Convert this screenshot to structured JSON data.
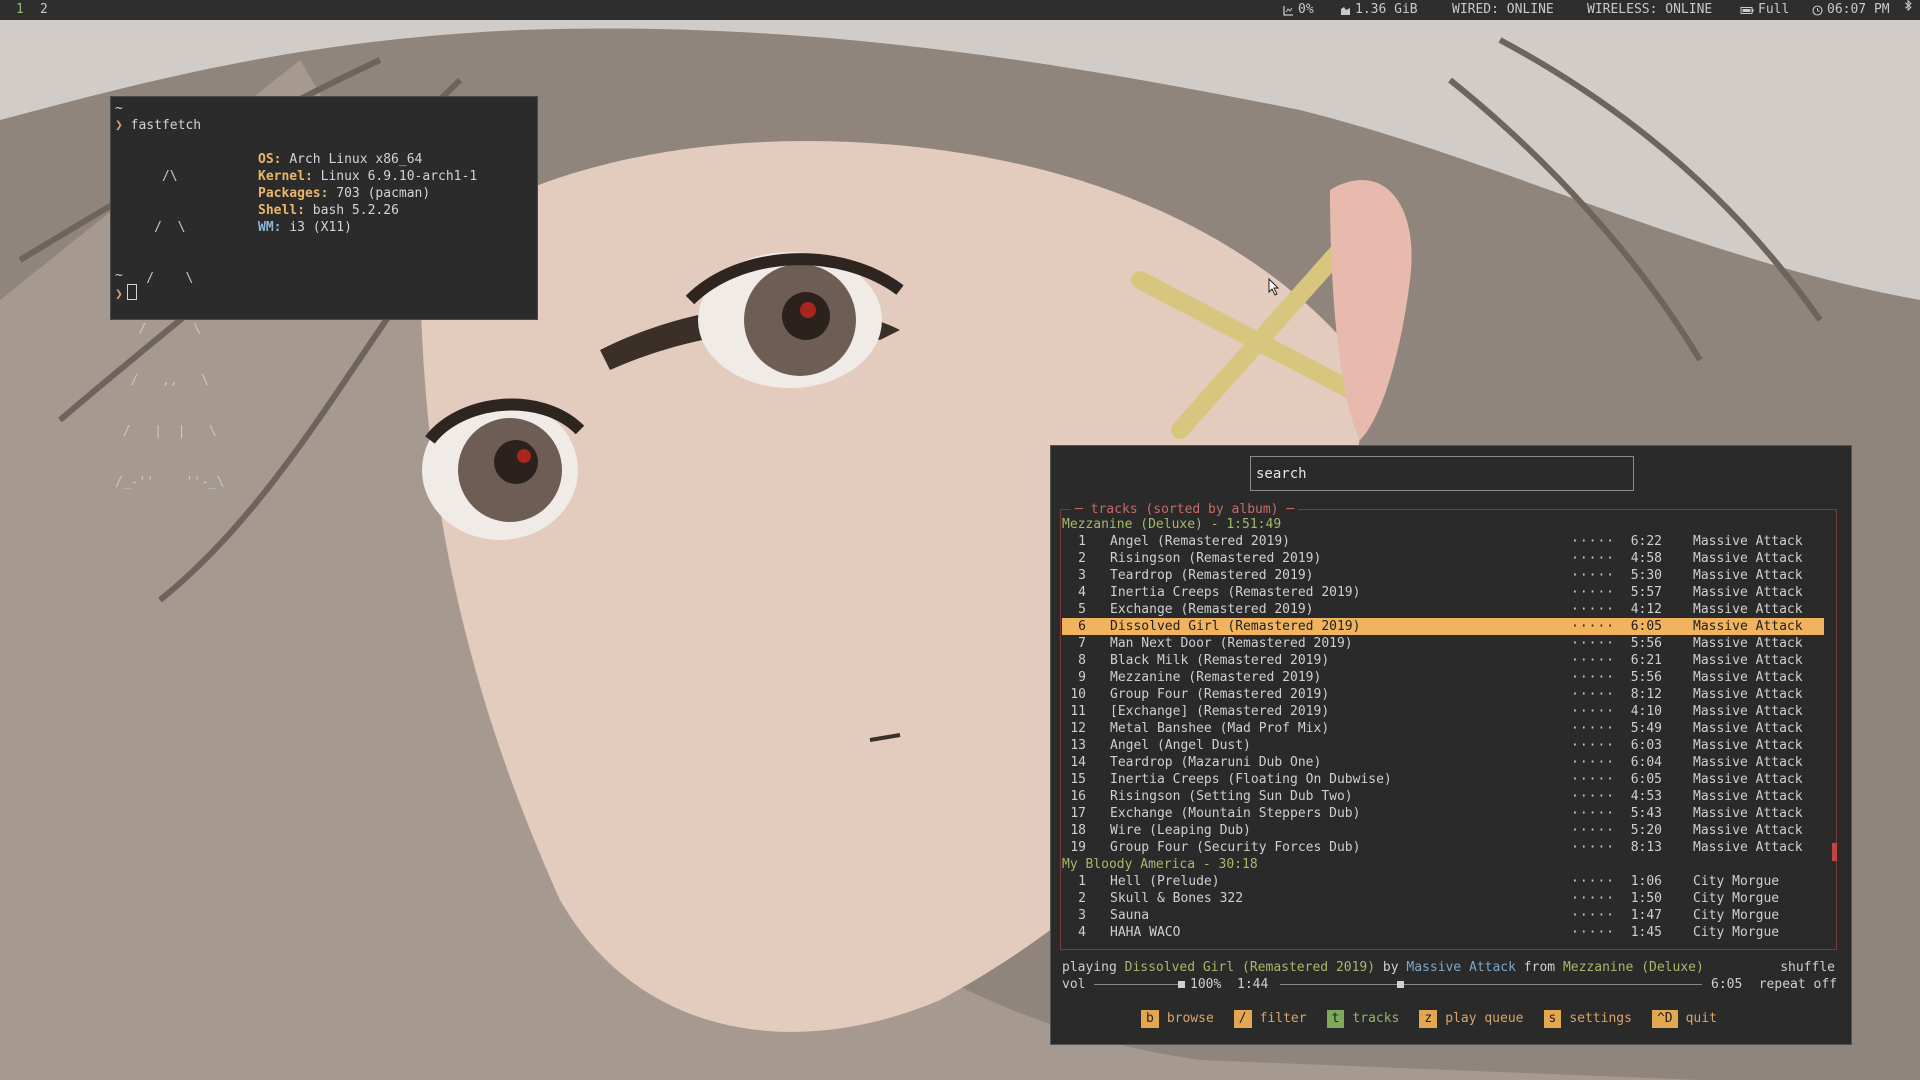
{
  "topbar": {
    "workspaces": [
      "1",
      "2"
    ],
    "cpu": "0%",
    "memory": "1.36 GiB",
    "wired": "WIRED: ONLINE",
    "wireless": "WIRELESS: ONLINE",
    "battery": "Full",
    "clock": "06:07 PM",
    "icons": [
      "cpu-icon",
      "memory-icon",
      "battery-icon",
      "clock-icon",
      "bluetooth-icon"
    ]
  },
  "terminal": {
    "line1": "~",
    "command": "fastfetch",
    "prompt_symbol": "❯",
    "logo_lines": [
      "      /\\",
      "     /  \\",
      "    /    \\",
      "   /      \\",
      "  /   ,,   \\",
      " /   |  |   \\",
      "/_-''    ''-_\\"
    ],
    "info": [
      {
        "key": "OS",
        "value": "Arch Linux x86_64"
      },
      {
        "key": "Kernel",
        "value": "Linux 6.9.10-arch1-1"
      },
      {
        "key": "Packages",
        "value": "703 (pacman)"
      },
      {
        "key": "Shell",
        "value": "bash 5.2.26"
      },
      {
        "key": "WM",
        "value": "i3 (X11)"
      }
    ],
    "line_after": "~"
  },
  "player": {
    "search_placeholder": "search",
    "box_title": "tracks (sorted by album)",
    "albums": [
      {
        "header": "Mezzanine (Deluxe) - 1:51:49",
        "tracks": [
          {
            "num": "1",
            "title": "Angel (Remastered 2019)",
            "rating": "·····",
            "duration": "6:22",
            "artist": "Massive Attack"
          },
          {
            "num": "2",
            "title": "Risingson (Remastered 2019)",
            "rating": "·····",
            "duration": "4:58",
            "artist": "Massive Attack"
          },
          {
            "num": "3",
            "title": "Teardrop (Remastered 2019)",
            "rating": "·····",
            "duration": "5:30",
            "artist": "Massive Attack"
          },
          {
            "num": "4",
            "title": "Inertia Creeps (Remastered 2019)",
            "rating": "·····",
            "duration": "5:57",
            "artist": "Massive Attack"
          },
          {
            "num": "5",
            "title": "Exchange (Remastered 2019)",
            "rating": "·····",
            "duration": "4:12",
            "artist": "Massive Attack"
          },
          {
            "num": "6",
            "title": "Dissolved Girl (Remastered 2019)",
            "rating": "·····",
            "duration": "6:05",
            "artist": "Massive Attack",
            "selected": true
          },
          {
            "num": "7",
            "title": "Man Next Door (Remastered 2019)",
            "rating": "·····",
            "duration": "5:56",
            "artist": "Massive Attack"
          },
          {
            "num": "8",
            "title": "Black Milk (Remastered 2019)",
            "rating": "·····",
            "duration": "6:21",
            "artist": "Massive Attack"
          },
          {
            "num": "9",
            "title": "Mezzanine (Remastered 2019)",
            "rating": "·····",
            "duration": "5:56",
            "artist": "Massive Attack"
          },
          {
            "num": "10",
            "title": "Group Four (Remastered 2019)",
            "rating": "·····",
            "duration": "8:12",
            "artist": "Massive Attack"
          },
          {
            "num": "11",
            "title": "[Exchange] (Remastered 2019)",
            "rating": "·····",
            "duration": "4:10",
            "artist": "Massive Attack"
          },
          {
            "num": "12",
            "title": "Metal Banshee (Mad Prof Mix)",
            "rating": "·····",
            "duration": "5:49",
            "artist": "Massive Attack"
          },
          {
            "num": "13",
            "title": "Angel (Angel Dust)",
            "rating": "·····",
            "duration": "6:03",
            "artist": "Massive Attack"
          },
          {
            "num": "14",
            "title": "Teardrop (Mazaruni Dub One)",
            "rating": "·····",
            "duration": "6:04",
            "artist": "Massive Attack"
          },
          {
            "num": "15",
            "title": "Inertia Creeps (Floating On Dubwise)",
            "rating": "·····",
            "duration": "6:05",
            "artist": "Massive Attack"
          },
          {
            "num": "16",
            "title": "Risingson (Setting Sun Dub Two)",
            "rating": "·····",
            "duration": "4:53",
            "artist": "Massive Attack"
          },
          {
            "num": "17",
            "title": "Exchange (Mountain Steppers Dub)",
            "rating": "·····",
            "duration": "5:43",
            "artist": "Massive Attack"
          },
          {
            "num": "18",
            "title": "Wire (Leaping Dub)",
            "rating": "·····",
            "duration": "5:20",
            "artist": "Massive Attack"
          },
          {
            "num": "19",
            "title": "Group Four (Security Forces Dub)",
            "rating": "·····",
            "duration": "8:13",
            "artist": "Massive Attack"
          }
        ]
      },
      {
        "header": "My Bloody America - 30:18",
        "tracks": [
          {
            "num": "1",
            "title": "Hell (Prelude)",
            "rating": "·····",
            "duration": "1:06",
            "artist": "City Morgue"
          },
          {
            "num": "2",
            "title": "Skull & Bones 322",
            "rating": "·····",
            "duration": "1:50",
            "artist": "City Morgue"
          },
          {
            "num": "3",
            "title": "Sauna",
            "rating": "·····",
            "duration": "1:47",
            "artist": "City Morgue"
          },
          {
            "num": "4",
            "title": "HAHA WACO",
            "rating": "·····",
            "duration": "1:45",
            "artist": "City Morgue"
          }
        ]
      }
    ],
    "now_playing": {
      "prefix": "playing",
      "title": "Dissolved Girl (Remastered 2019)",
      "by": "by",
      "artist": "Massive Attack",
      "from": "from",
      "album": "Mezzanine (Deluxe)",
      "shuffle": "shuffle",
      "vol_label": "vol",
      "volume": "100%",
      "volume_fraction": 1.0,
      "position": "1:44",
      "duration": "6:05",
      "progress_fraction": 0.285,
      "repeat": "repeat off"
    },
    "keys": [
      {
        "key": "b",
        "label": "browse"
      },
      {
        "key": "/",
        "label": "filter"
      },
      {
        "key": "t",
        "label": "tracks",
        "active": true
      },
      {
        "key": "z",
        "label": "play queue"
      },
      {
        "key": "s",
        "label": "settings"
      },
      {
        "key": "^D",
        "label": "quit"
      }
    ]
  },
  "colors": {
    "bar_bg": "#2e2e2e",
    "window_bg": "#2a2a2a",
    "selection": "#f1b35e",
    "album_header": "#a6b96a",
    "box_border": "#7a3b3b",
    "key_bg": "#e3a750",
    "key_active_bg": "#7ea95b"
  }
}
